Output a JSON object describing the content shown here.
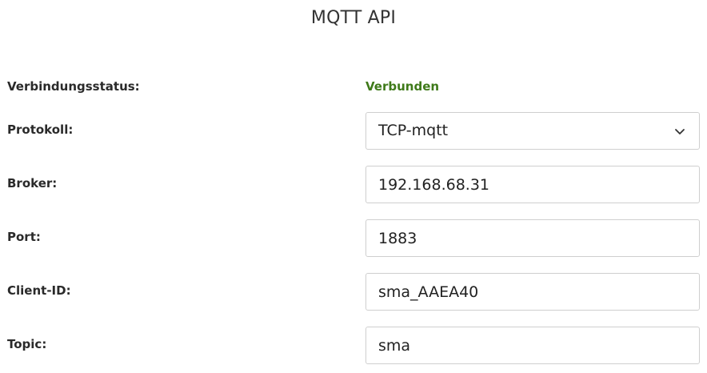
{
  "title": "MQTT API",
  "status": {
    "label": "Verbindungsstatus:",
    "value": "Verbunden",
    "color": "#3f7a1a"
  },
  "protocol": {
    "label": "Protokoll:",
    "value": "TCP-mqtt",
    "icon": "chevron-down-icon"
  },
  "broker": {
    "label": "Broker:",
    "value": "192.168.68.31"
  },
  "port": {
    "label": "Port:",
    "value": "1883"
  },
  "client_id": {
    "label": "Client-ID:",
    "value": "sma_AAEA40"
  },
  "topic": {
    "label": "Topic:",
    "value": "sma"
  }
}
